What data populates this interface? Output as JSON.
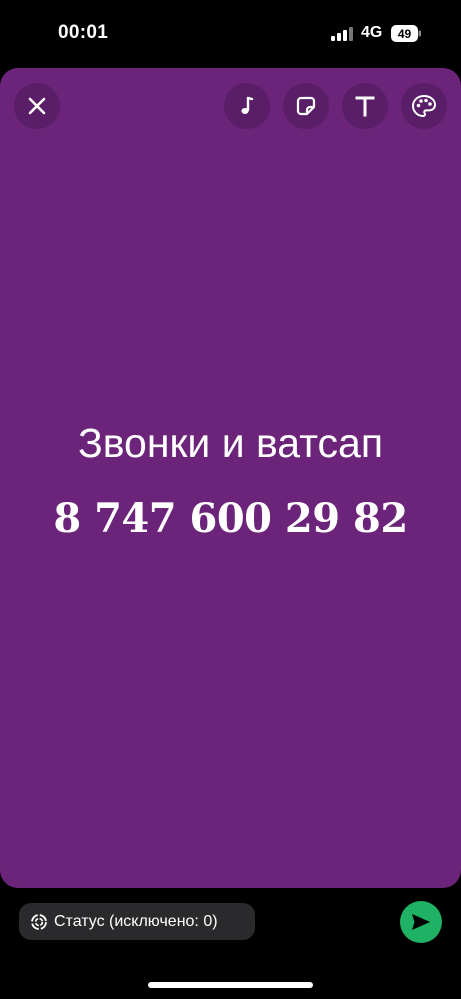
{
  "status_bar": {
    "time": "00:01",
    "network": "4G",
    "battery": "49"
  },
  "toolbar": {
    "close_icon": "close-icon",
    "music_icon": "music-note-icon",
    "sticker_icon": "sticker-icon",
    "text_icon": "text-icon",
    "palette_icon": "palette-icon"
  },
  "story": {
    "background_color": "#6b2479",
    "line1": "Звонки и ватсап",
    "line2": "8 747 600 29 82"
  },
  "footer": {
    "status_label": "Статус (исключено: 0)",
    "send_color": "#1fb264"
  }
}
